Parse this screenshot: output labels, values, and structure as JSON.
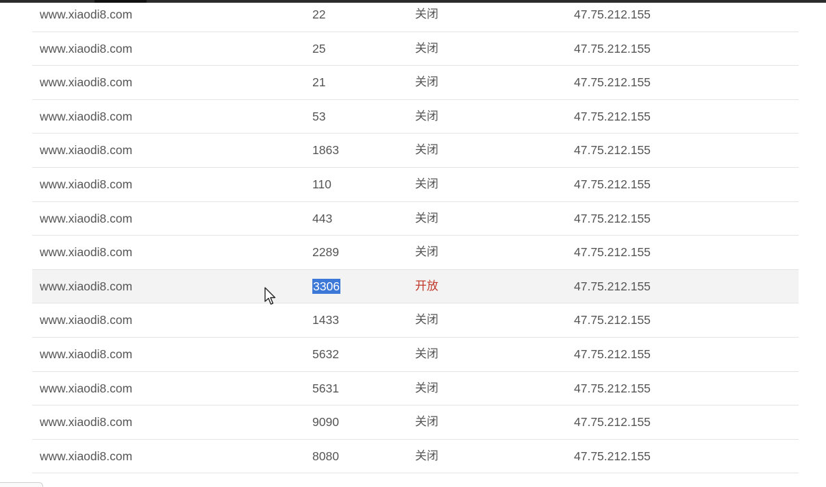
{
  "table": {
    "rows": [
      {
        "domain": "www.xiaodi8.com",
        "port": "22",
        "status": "关闭",
        "ip": "47.75.212.155"
      },
      {
        "domain": "www.xiaodi8.com",
        "port": "25",
        "status": "关闭",
        "ip": "47.75.212.155"
      },
      {
        "domain": "www.xiaodi8.com",
        "port": "21",
        "status": "关闭",
        "ip": "47.75.212.155"
      },
      {
        "domain": "www.xiaodi8.com",
        "port": "53",
        "status": "关闭",
        "ip": "47.75.212.155"
      },
      {
        "domain": "www.xiaodi8.com",
        "port": "1863",
        "status": "关闭",
        "ip": "47.75.212.155"
      },
      {
        "domain": "www.xiaodi8.com",
        "port": "110",
        "status": "关闭",
        "ip": "47.75.212.155"
      },
      {
        "domain": "www.xiaodi8.com",
        "port": "443",
        "status": "关闭",
        "ip": "47.75.212.155"
      },
      {
        "domain": "www.xiaodi8.com",
        "port": "2289",
        "status": "关闭",
        "ip": "47.75.212.155"
      },
      {
        "domain": "www.xiaodi8.com",
        "port": "3306",
        "status": "开放",
        "ip": "47.75.212.155"
      },
      {
        "domain": "www.xiaodi8.com",
        "port": "1433",
        "status": "关闭",
        "ip": "47.75.212.155"
      },
      {
        "domain": "www.xiaodi8.com",
        "port": "5632",
        "status": "关闭",
        "ip": "47.75.212.155"
      },
      {
        "domain": "www.xiaodi8.com",
        "port": "5631",
        "status": "关闭",
        "ip": "47.75.212.155"
      },
      {
        "domain": "www.xiaodi8.com",
        "port": "9090",
        "status": "关闭",
        "ip": "47.75.212.155"
      },
      {
        "domain": "www.xiaodi8.com",
        "port": "8080",
        "status": "关闭",
        "ip": "47.75.212.155"
      }
    ]
  },
  "colors": {
    "open_status": "#c0392b",
    "selection": "#3b78d8",
    "text": "#555555"
  }
}
